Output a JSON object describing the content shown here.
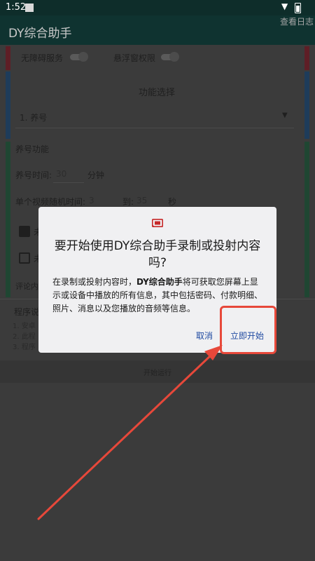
{
  "status": {
    "time": "1:52"
  },
  "appbar": {
    "title": "DY综合助手",
    "log_button": "查看日志"
  },
  "settings": {
    "accessibility_label": "无障碍服务",
    "overlay_label": "悬浮窗权限",
    "section_title": "功能选择",
    "spinner_value": "1. 养号",
    "feature_title": "养号功能",
    "time_label": "养号时间:",
    "time_value": "30",
    "time_unit": "分钟",
    "video_label": "单个视频随机时间:",
    "video_from": "3",
    "to_label": "到:",
    "video_to": "35",
    "sec_unit": "秒",
    "check1_text": "未",
    "check2_text": "未",
    "comment_label": "评论内",
    "notes_title": "程序说",
    "note1": "1. 安卓",
    "note2": "2. 此程",
    "note3": "3. 程序",
    "start_run": "开始运行"
  },
  "dialog": {
    "heading": "要开始使用DY综合助手录制或投射内容吗?",
    "body_prefix": "在录制或投射内容时，",
    "body_app": "DY综合助手",
    "body_suffix": "将可获取您屏幕上显示或设备中播放的所有信息，其中包括密码、付款明细、照片、消息以及您播放的音频等信息。",
    "cancel": "取消",
    "start_now": "立即开始"
  },
  "colors": {
    "accent": "#1f4aa1",
    "annotation": "#e7483a",
    "dim_bg": "#3b3b3b"
  },
  "icons": {
    "cast": "cast-icon",
    "wifi": "wifi-icon",
    "battery": "battery-icon"
  }
}
